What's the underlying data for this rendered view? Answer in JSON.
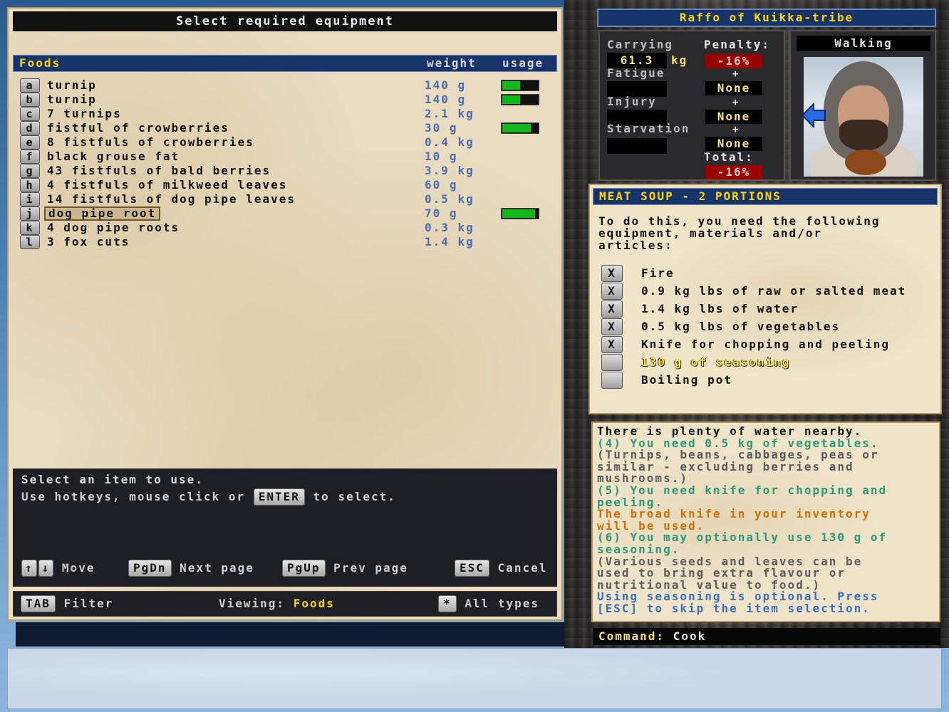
{
  "left_panel": {
    "title": "Select required equipment",
    "header": {
      "category": "Foods",
      "weight": "weight",
      "usage": "usage"
    },
    "items": [
      {
        "key": "a",
        "name": "turnip",
        "weight": "140 g",
        "usage": 0.5,
        "selected": false
      },
      {
        "key": "b",
        "name": "turnip",
        "weight": "140 g",
        "usage": 0.5,
        "selected": false
      },
      {
        "key": "c",
        "name": "7 turnips",
        "weight": "2.1 kg",
        "usage": null,
        "selected": false
      },
      {
        "key": "d",
        "name": "fistful of crowberries",
        "weight": "30 g",
        "usage": 0.8,
        "selected": false
      },
      {
        "key": "e",
        "name": "8 fistfuls of crowberries",
        "weight": "0.4 kg",
        "usage": null,
        "selected": false
      },
      {
        "key": "f",
        "name": "black grouse fat",
        "weight": "10 g",
        "usage": null,
        "selected": false
      },
      {
        "key": "g",
        "name": "43 fistfuls of bald berries",
        "weight": "3.9 kg",
        "usage": null,
        "selected": false
      },
      {
        "key": "h",
        "name": "4 fistfuls of milkweed leaves",
        "weight": "60 g",
        "usage": null,
        "selected": false
      },
      {
        "key": "i",
        "name": "14 fistfuls of dog pipe leaves",
        "weight": "0.5 kg",
        "usage": null,
        "selected": false
      },
      {
        "key": "j",
        "name": "dog pipe root",
        "weight": "70 g",
        "usage": 0.92,
        "selected": true
      },
      {
        "key": "k",
        "name": "4 dog pipe roots",
        "weight": "0.3 kg",
        "usage": null,
        "selected": false
      },
      {
        "key": "l",
        "name": "3 fox cuts",
        "weight": "1.4 kg",
        "usage": null,
        "selected": false
      }
    ],
    "help": {
      "line1": "Select an item to use.",
      "line2_pre": "Use hotkeys, mouse click or",
      "line2_key": "ENTER",
      "line2_post": "to select."
    },
    "keys": {
      "up": "↑",
      "down": "↓",
      "move": "Move",
      "pgdn": "PgDn",
      "next_page": "Next page",
      "pgup": "PgUp",
      "prev_page": "Prev page",
      "esc": "ESC",
      "cancel": "Cancel"
    },
    "filter_bar": {
      "tab_key": "TAB",
      "filter": "Filter",
      "viewing_label": "Viewing:",
      "viewing_value": "Foods",
      "star_key": "*",
      "all_types": "All types"
    }
  },
  "character": {
    "title": "Raffo of Kuikka-tribe",
    "status": "Walking",
    "carrying_label": "Carrying",
    "carrying_value": "61.3",
    "carrying_unit": "kg",
    "penalty_label": "Penalty:",
    "penalty_value": "-16%",
    "fatigue_label": "Fatigue",
    "fatigue_penalty": "None",
    "injury_label": "Injury",
    "injury_penalty": "None",
    "starvation_label": "Starvation",
    "starvation_penalty": "None",
    "total_label": "Total:",
    "total_value": "-16%",
    "plus": "+"
  },
  "recipe": {
    "title": "MEAT SOUP - 2 PORTIONS",
    "intro_lines": [
      "To do this, you need the following",
      "equipment, materials and/or",
      "articles:"
    ],
    "requirements": [
      {
        "checked": true,
        "mark": "X",
        "text": "Fire",
        "optional": false
      },
      {
        "checked": true,
        "mark": "X",
        "text": "0.9 kg lbs of raw or salted meat",
        "optional": false
      },
      {
        "checked": true,
        "mark": "X",
        "text": "1.4 kg lbs of water",
        "optional": false
      },
      {
        "checked": true,
        "mark": "X",
        "text": "0.5 kg lbs of vegetables",
        "optional": false
      },
      {
        "checked": true,
        "mark": "X",
        "text": "Knife for chopping and peeling",
        "optional": false
      },
      {
        "checked": false,
        "mark": "",
        "text": "130 g of seasoning",
        "optional": true
      },
      {
        "checked": false,
        "mark": "",
        "text": "Boiling pot",
        "optional": false
      }
    ]
  },
  "info": {
    "lines": [
      {
        "text": "There is plenty of water nearby.",
        "color": "black"
      },
      {
        "text": "(4) You need 0.5 kg of vegetables.",
        "color": "green"
      },
      {
        "text": "(Turnips, beans, cabbages, peas or",
        "color": "grey"
      },
      {
        "text": "similar - excluding berries and",
        "color": "grey"
      },
      {
        "text": "mushrooms.)",
        "color": "grey"
      },
      {
        "text": "(5) You need knife for chopping and",
        "color": "green"
      },
      {
        "text": "peeling.",
        "color": "green"
      },
      {
        "text": "The broad knife in your inventory",
        "color": "orange"
      },
      {
        "text": "will be used.",
        "color": "orange"
      },
      {
        "text": "(6) You may optionally use 130 g of",
        "color": "green"
      },
      {
        "text": "seasoning.",
        "color": "green"
      },
      {
        "text": "(Various seeds and leaves can be",
        "color": "grey"
      },
      {
        "text": "used to bring extra flavour or",
        "color": "grey"
      },
      {
        "text": "nutritional value to food.)",
        "color": "grey"
      },
      {
        "text": "Using seasoning is optional. Press",
        "color": "blue"
      },
      {
        "text": "[ESC] to skip the item selection.",
        "color": "blue"
      }
    ]
  },
  "command": {
    "label": "Command:",
    "value": "Cook"
  },
  "colors": {
    "header_bg": "#17346a",
    "header_text": "#ffd400",
    "usage_bar": "#10b81a",
    "weight_text": "#4a6fb5",
    "penalty_red": "#9a0000"
  },
  "icons": {
    "arrow": "left-arrow-icon",
    "up": "arrow-up-icon",
    "down": "arrow-down-icon"
  }
}
